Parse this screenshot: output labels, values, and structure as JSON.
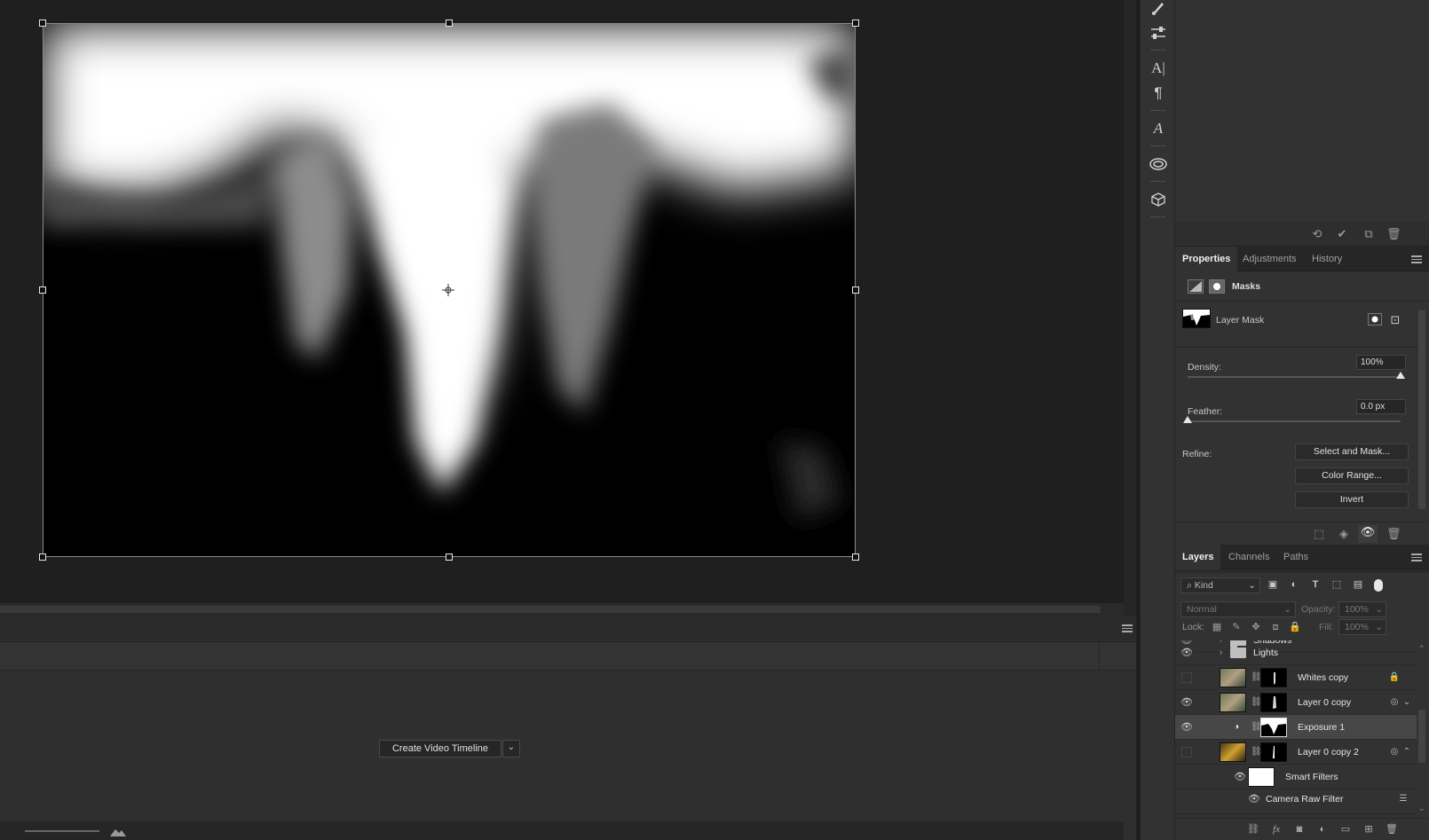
{
  "timeline": {
    "create_button_label": "Create Video Timeline",
    "create_button_arrow": "⌄"
  },
  "properties_panel": {
    "tabs": [
      {
        "label": "Properties",
        "active": true
      },
      {
        "label": "Adjustments",
        "active": false
      },
      {
        "label": "History",
        "active": false
      }
    ],
    "section_title": "Masks",
    "mask_type_label": "Layer Mask",
    "density_label": "Density:",
    "density_value": "100%",
    "density_level": 1.0,
    "feather_label": "Feather:",
    "feather_value": "0.0 px",
    "feather_level": 0.0,
    "refine_label": "Refine:",
    "refine_buttons": [
      "Select and Mask...",
      "Color Range...",
      "Invert"
    ]
  },
  "layers_panel": {
    "tabs": [
      {
        "label": "Layers",
        "active": true
      },
      {
        "label": "Channels",
        "active": false
      },
      {
        "label": "Paths",
        "active": false
      }
    ],
    "filter_kind": "Kind",
    "blend_mode": "Normal",
    "opacity_label": "Opacity:",
    "opacity_value": "100%",
    "lock_label": "Lock:",
    "fill_label": "Fill:",
    "fill_value": "100%",
    "layers": [
      {
        "name": "Shadows",
        "type": "group",
        "visible": true,
        "partial": true
      },
      {
        "name": "Lights",
        "type": "group",
        "visible": true
      },
      {
        "name": "Whites copy",
        "type": "pixel",
        "visible": false,
        "badge": "lock-icon"
      },
      {
        "name": "Layer 0 copy",
        "type": "smart",
        "visible": true,
        "badge": "smart-filter-icon"
      },
      {
        "name": "Exposure 1",
        "type": "adjustment",
        "visible": true,
        "selected": true
      },
      {
        "name": "Layer 0 copy 2",
        "type": "smart",
        "visible": false,
        "badge": "smart-filter-icon"
      },
      {
        "name": "Smart Filters",
        "type": "smart-filters",
        "visible": true
      },
      {
        "name": "Camera Raw Filter",
        "type": "filter",
        "visible": true
      }
    ]
  },
  "colors": {
    "panel_bg": "#323232",
    "canvas_bg": "#1f1f1f",
    "selected_row": "#474747"
  }
}
